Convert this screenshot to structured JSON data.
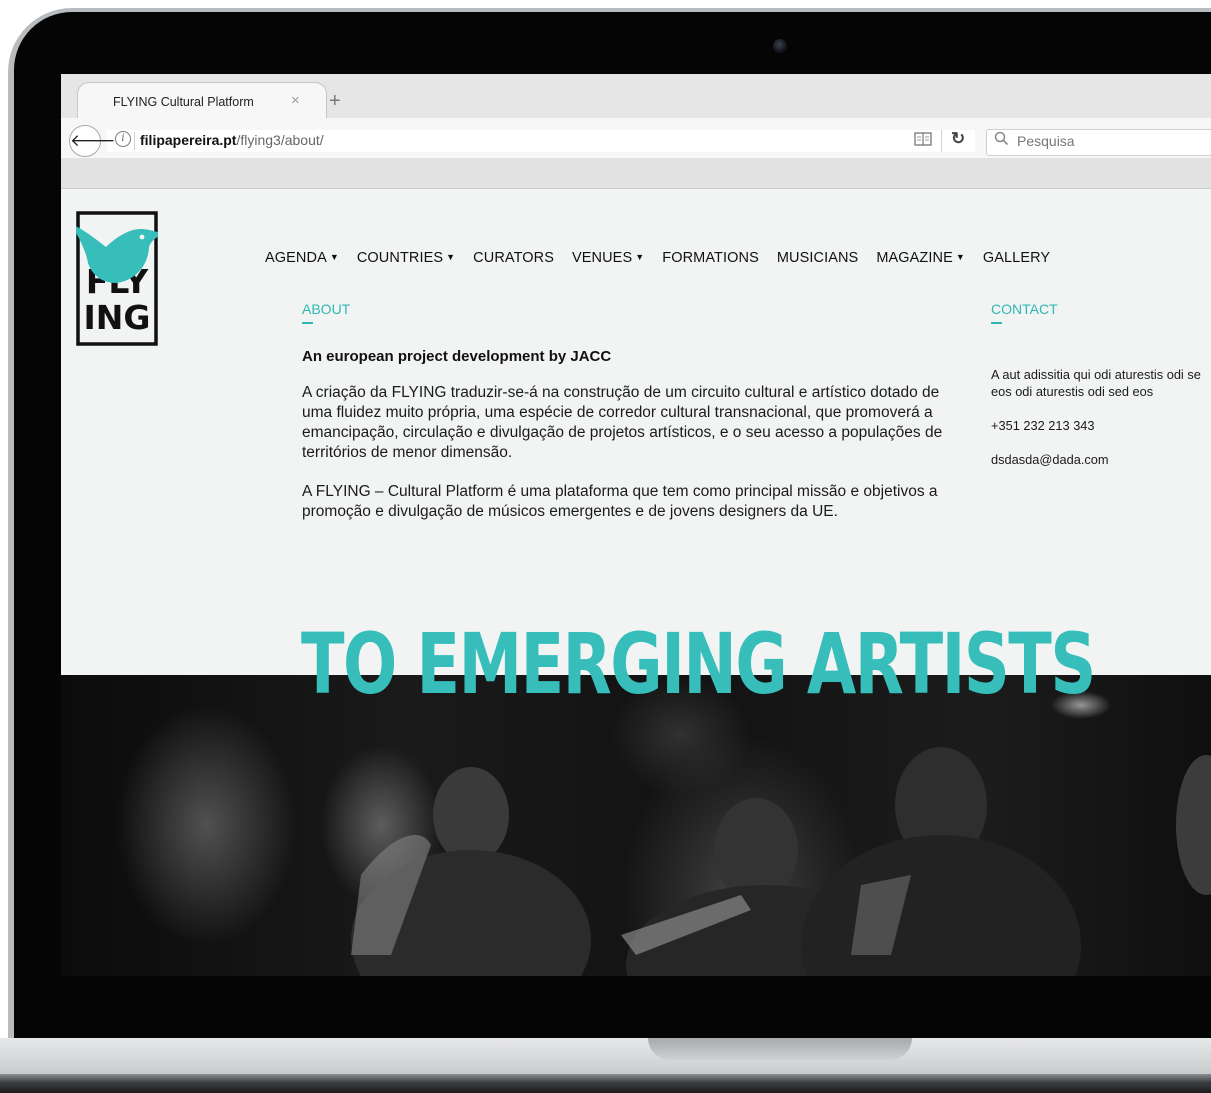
{
  "browser": {
    "tab_title": "FLYING Cultural Platform",
    "tab_close": "×",
    "new_tab": "+",
    "url_domain": "filipapereira.pt",
    "url_path": "/flying3/about/",
    "search_placeholder": "Pesquisa"
  },
  "site": {
    "logo": {
      "line1": "FLY",
      "line2": "ING"
    },
    "nav": [
      {
        "label": "AGENDA",
        "dropdown": true
      },
      {
        "label": "COUNTRIES",
        "dropdown": true
      },
      {
        "label": "CURATORS",
        "dropdown": false
      },
      {
        "label": "VENUES",
        "dropdown": true
      },
      {
        "label": "FORMATIONS",
        "dropdown": false
      },
      {
        "label": "MUSICIANS",
        "dropdown": false
      },
      {
        "label": "MAGAZINE",
        "dropdown": true
      },
      {
        "label": "GALLERY",
        "dropdown": false
      }
    ],
    "about": {
      "label": "ABOUT",
      "heading": "An european project development by JACC",
      "paragraph1": "A criação da FLYING traduzir-se-á na construção de um circuito cultural e artístico dotado de uma fluidez muito própria, uma espécie de corredor cultural transnacional, que promoverá a emancipação, circulação e divulgação de projetos artísticos, e o seu acesso a populações de territórios de menor dimensão.",
      "paragraph2": "A FLYING – Cultural Platform é uma plataforma que tem como principal missão e objetivos a promoção e divulgação de músicos emergentes e de jovens designers da UE."
    },
    "contact": {
      "label": "CONTACT",
      "address": "A aut adissitia qui odi aturestis odi se\neos odi aturestis odi sed eos",
      "phone": "+351 232 213 343",
      "email": "dsdasda@dada.com"
    },
    "hero_title": "TO EMERGING ARTISTS"
  },
  "colors": {
    "accent": "#37bebb",
    "page_bg": "#f1f4f2"
  }
}
